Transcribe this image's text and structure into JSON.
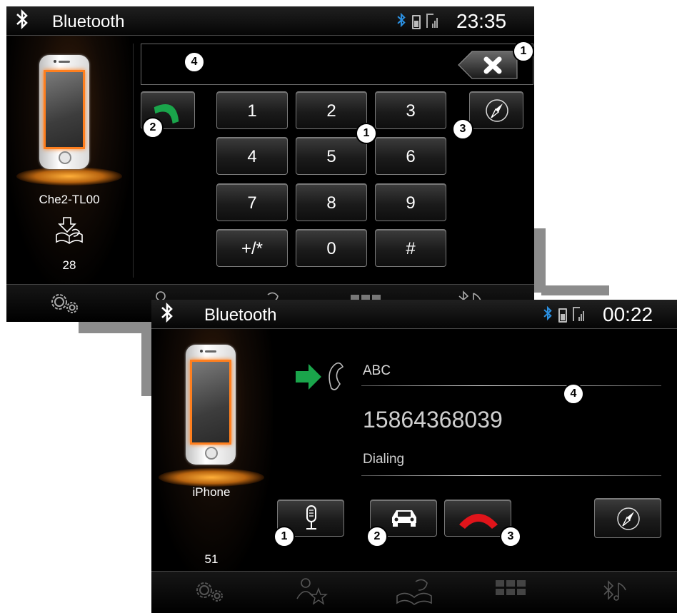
{
  "screen1": {
    "title": "Bluetooth",
    "time": "23:35",
    "device_name": "Che2-TL00",
    "count": "28",
    "keypad": [
      "1",
      "2",
      "3",
      "4",
      "5",
      "6",
      "7",
      "8",
      "9",
      "+/*",
      "0",
      "#"
    ],
    "callouts": {
      "backspace": "1",
      "keypad": "1",
      "call": "2",
      "navigation": "3",
      "number_field": "4"
    }
  },
  "screen2": {
    "title": "Bluetooth",
    "time": "00:22",
    "device_name": "iPhone",
    "count": "51",
    "contact_name": "ABC",
    "phone_number": "15864368039",
    "call_status": "Dialing",
    "callouts": {
      "mic": "1",
      "car": "2",
      "hangup": "3",
      "info_divider": "4"
    }
  },
  "bottom_nav": [
    "settings-icon",
    "contact-star-icon",
    "phonebook-icon",
    "grid-icon",
    "bluetooth-music-icon"
  ],
  "colors": {
    "accent_orange": "#ff7f1e",
    "bluetooth_blue": "#2b8fe0",
    "call_green": "#1aa54b",
    "hangup_red": "#e0141a"
  }
}
